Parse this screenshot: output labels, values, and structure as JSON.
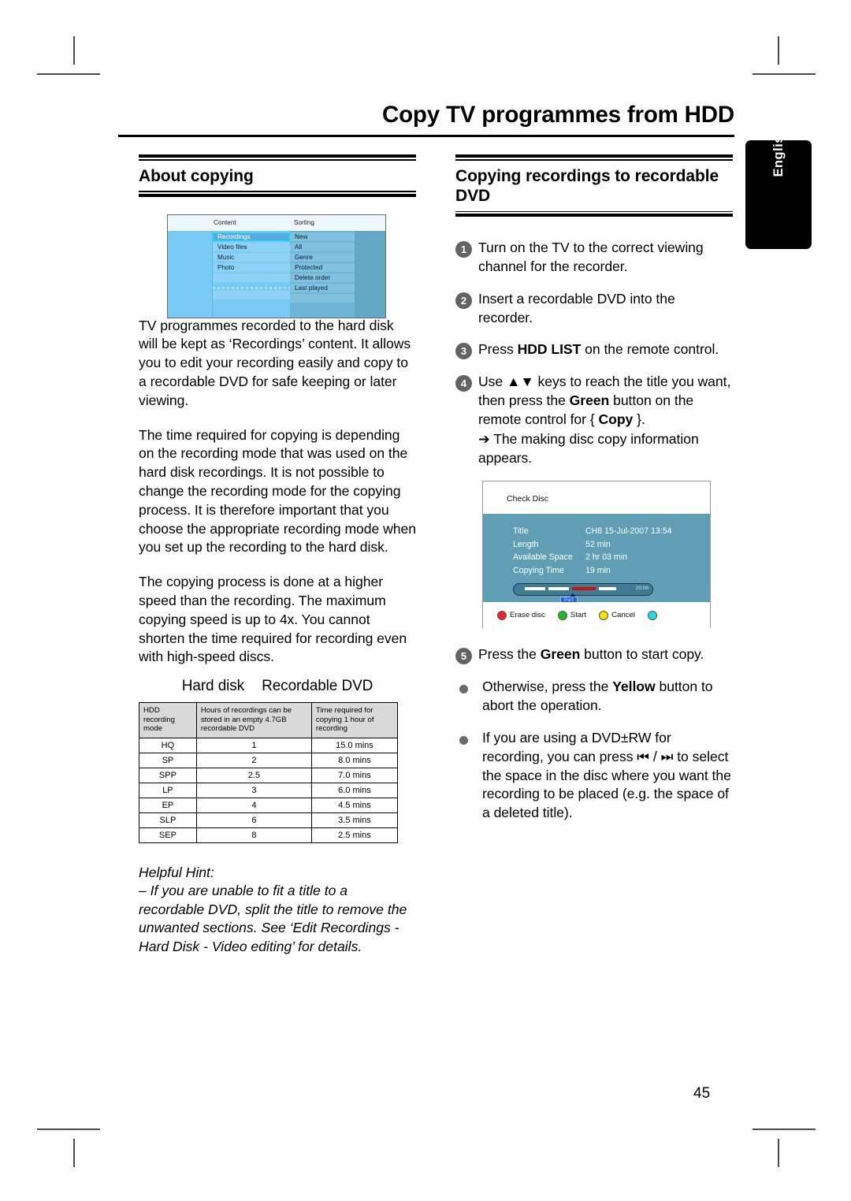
{
  "header": {
    "chapter_title": "Copy TV programmes from HDD",
    "language_tab": "English",
    "page_number": "45"
  },
  "left_column": {
    "section_title": "About copying",
    "menu_screenshot": {
      "col_content_header": "Content",
      "col_sorting_header": "Sorting",
      "content_items": [
        "Recordings",
        "Video files",
        "Music",
        "Photo"
      ],
      "sorting_items": [
        "New",
        "All",
        "Genre",
        "Protected",
        "Delete order",
        "Last played"
      ],
      "selected_content": "Recordings"
    },
    "paragraphs": [
      "TV programmes recorded to the hard disk will be kept as ‘Recordings’ content. It allows you to edit your recording easily and copy to a recordable DVD for safe keeping or later viewing.",
      "The time required for copying is depending on the recording mode that was used on the hard disk recordings.  It is not possible to change the recording mode for the copying process. It is therefore important that you choose the appropriate recording mode when you set up the recording to the hard disk.",
      "The copying process is done at a higher speed than the recording. The maximum copying speed is up to 4x.  You cannot shorten the time required for recording even with high-speed discs."
    ],
    "table_caption_left": "Hard disk",
    "table_caption_right": "Recordable DVD",
    "comparison_table": {
      "headers": [
        "HDD recording mode",
        "Hours of recordings can be stored in an empty 4.7GB recordable DVD",
        "Time required for copying 1 hour of recording"
      ],
      "rows": [
        [
          "HQ",
          "1",
          "15.0 mins"
        ],
        [
          "SP",
          "2",
          "8.0 mins"
        ],
        [
          "SPP",
          "2.5",
          "7.0 mins"
        ],
        [
          "LP",
          "3",
          "6.0 mins"
        ],
        [
          "EP",
          "4",
          "4.5 mins"
        ],
        [
          "SLP",
          "6",
          "3.5 mins"
        ],
        [
          "SEP",
          "8",
          "2.5 mins"
        ]
      ]
    },
    "hint": {
      "title": "Helpful Hint:",
      "line1": "– If you are unable to fit a title to a",
      "line2": "recordable DVD, split the title to remove the",
      "line3": "unwanted sections. See ‘Edit Recordings -",
      "line4": "Hard Disk - Video editing’ for details."
    }
  },
  "right_column": {
    "section_title": "Copying recordings to recordable DVD",
    "steps": [
      {
        "num": "1",
        "text": "Turn on the TV to the correct viewing channel for the recorder."
      },
      {
        "num": "2",
        "text": "Insert a recordable DVD into the recorder."
      },
      {
        "num": "3",
        "text_before": "Press ",
        "bold": "HDD LIST",
        "text_after": " on the remote control."
      },
      {
        "num": "4",
        "text_a": "Use ▲▼ keys to reach the title you want, then press the ",
        "bold_a": "Green",
        "text_b": " button on the remote control for { ",
        "bold_b": "Copy",
        "text_c": " }.",
        "sub": "➔ The making disc copy information appears."
      },
      {
        "num": "5",
        "text_before": "Press the ",
        "bold": "Green",
        "text_after": " button to start copy."
      }
    ],
    "bullets": [
      {
        "text_before": "Otherwise, press the ",
        "bold": "Yellow",
        "text_after": " button to abort the operation."
      },
      {
        "text": "If you are using a DVD±RW for recording, you can press ⏮ / ⏭ to select the space in the disc where you want the recording to be placed (e.g. the space of a deleted title)."
      }
    ],
    "check_disc_screenshot": {
      "title": "Check Disc",
      "fields": [
        {
          "key": "Title",
          "value": "CH8 15-Jul-2007 13:54"
        },
        {
          "key": "Length",
          "value": "52 min"
        },
        {
          "key": "Available Space",
          "value": "2 hr 03 min"
        },
        {
          "key": "Copying Time",
          "value": "19 min"
        }
      ],
      "bar_time": "20:08",
      "bar_badge": "Part",
      "buttons": [
        {
          "color": "red",
          "label": "Erase disc"
        },
        {
          "color": "green",
          "label": "Start"
        },
        {
          "color": "yellow",
          "label": "Cancel"
        },
        {
          "color": "cyan",
          "label": ""
        }
      ]
    }
  },
  "colors": {
    "accent_black": "#000000",
    "menu_blue": "#79cbf5",
    "panel_blue": "#5f9eb5",
    "num_grey": "#636363",
    "red": "#e8252a",
    "green": "#1fbb26",
    "yellow": "#f5e400",
    "cyan": "#27d8e8"
  }
}
